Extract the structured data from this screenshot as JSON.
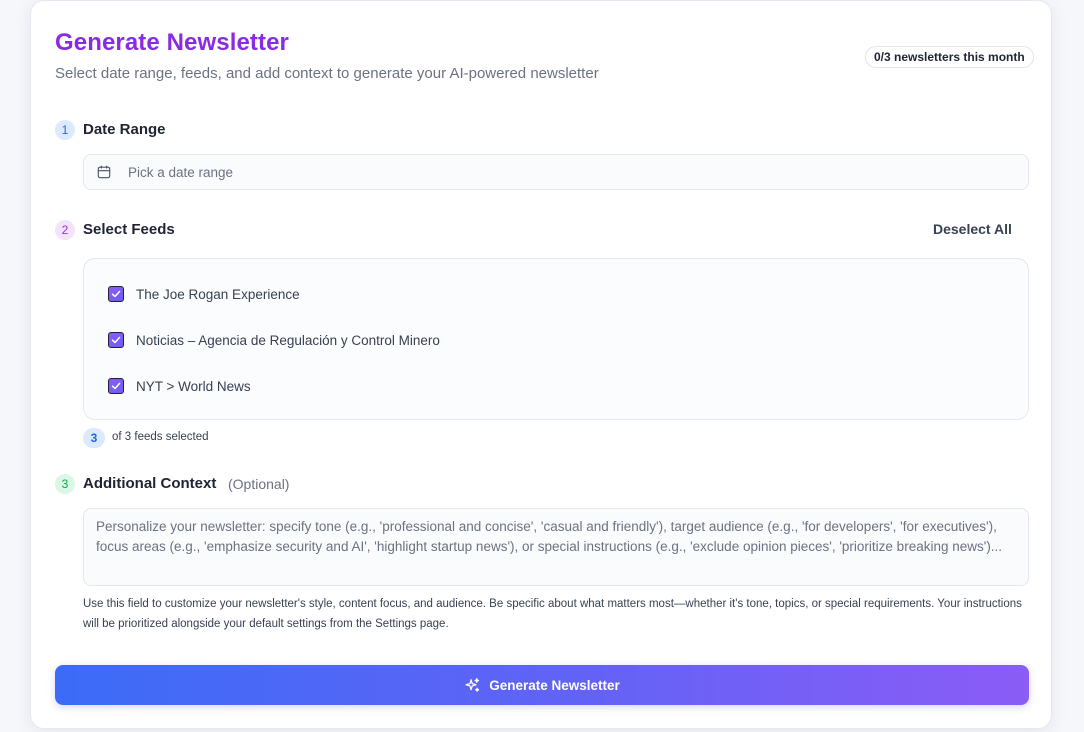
{
  "header": {
    "title": "Generate Newsletter",
    "subtitle": "Select date range, feeds, and add context to generate your AI-powered newsletter",
    "quota_badge": "0/3 newsletters this month"
  },
  "steps": {
    "date_range": {
      "number": "1",
      "heading": "Date Range",
      "placeholder": "Pick a date range",
      "icon": "calendar-icon"
    },
    "feeds": {
      "number": "2",
      "heading": "Select Feeds",
      "deselect_label": "Deselect All",
      "items": [
        {
          "label": "The Joe Rogan Experience",
          "checked": true
        },
        {
          "label": "Noticias – Agencia de Regulación y Control Minero",
          "checked": true
        },
        {
          "label": "NYT > World News",
          "checked": true
        }
      ],
      "selected_count": "3",
      "selected_text": "of 3 feeds selected"
    },
    "context": {
      "number": "3",
      "heading": "Additional Context",
      "optional": "(Optional)",
      "placeholder": "Personalize your newsletter: specify tone (e.g., 'professional and concise', 'casual and friendly'), target audience (e.g., 'for developers', 'for executives'), focus areas (e.g., 'emphasize security and AI', 'highlight startup news'), or special instructions (e.g., 'exclude opinion pieces', 'prioritize breaking news')...",
      "help": "Use this field to customize your newsletter's style, content focus, and audience. Be specific about what matters most—whether it's tone, topics, or special requirements. Your instructions will be prioritized alongside your default settings from the Settings page."
    }
  },
  "actions": {
    "generate_label": "Generate Newsletter",
    "generate_icon": "sparkles-icon"
  },
  "colors": {
    "title": "#8a2be2",
    "button_gradient_start": "#3b6cf7",
    "button_gradient_end": "#8b5cf6",
    "checkbox": "#8b5cf6"
  }
}
